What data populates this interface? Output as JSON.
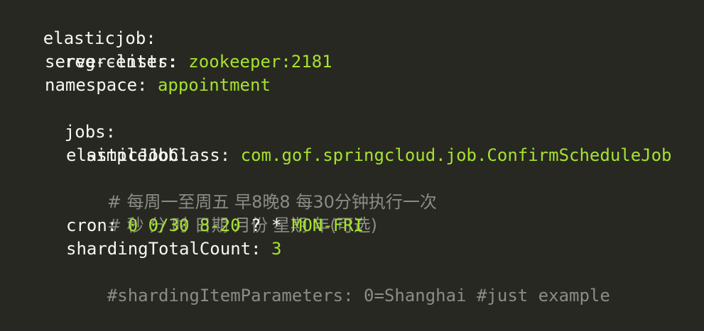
{
  "editor": {
    "lines": [
      {
        "key": "elasticjob:",
        "value": ""
      },
      {
        "key": "reg-center:",
        "value": ""
      },
      {
        "key": "server-lists: ",
        "value": "zookeeper:2181"
      },
      {
        "key": "namespace: ",
        "value": "appointment"
      },
      {
        "key": "jobs:",
        "value": ""
      },
      {
        "key": "simpleJob:",
        "value": ""
      },
      {
        "key": "elasticJobClass: ",
        "value": "com.gof.springcloud.job.ConfirmScheduleJob"
      },
      {
        "comment": "# 每周一至周五 早8晚8 每30分钟执行一次"
      },
      {
        "comment": "# 秒 分 时 日期 月份 星期 年(可选)"
      },
      {
        "key": "cron: ",
        "value_a": "0 0/30 8-20 ",
        "value_b": "? * ",
        "value_c": "MON-FRI"
      },
      {
        "key": "shardingTotalCount: ",
        "value": "3"
      },
      {
        "comment": "#shardingItemParameters: 0=Shanghai #just example"
      }
    ]
  },
  "theme": {
    "background": "#272822",
    "foreground": "#f8f8f2",
    "string": "#a6e22e",
    "comment": "#8c8c86"
  }
}
